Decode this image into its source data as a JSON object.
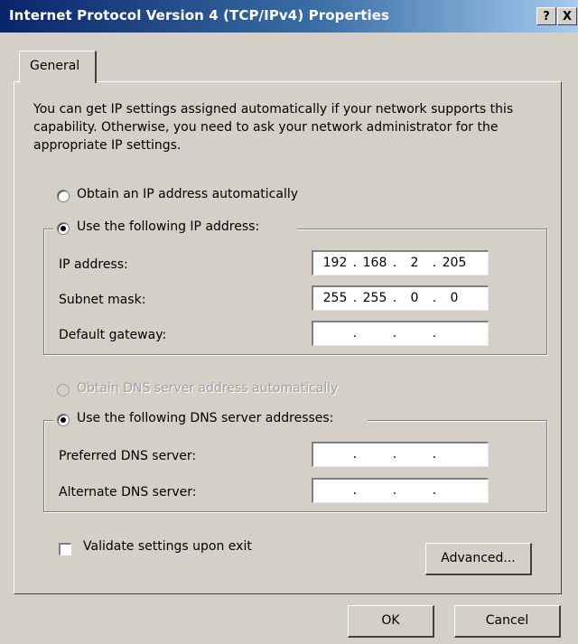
{
  "window": {
    "title": "Internet Protocol Version 4 (TCP/IPv4) Properties",
    "help_button": "?",
    "close_button": "X"
  },
  "tabs": [
    {
      "label": "General"
    }
  ],
  "description": "You can get IP settings assigned automatically if your network supports this capability. Otherwise, you need to ask your network administrator for the appropriate IP settings.",
  "ip_options": {
    "auto_label": "Obtain an IP address automatically",
    "manual_label": "Use the following IP address:",
    "selected": "manual"
  },
  "ip_fields": [
    {
      "label": "IP address:",
      "octets": [
        "192",
        "168",
        "2",
        "205"
      ]
    },
    {
      "label": "Subnet mask:",
      "octets": [
        "255",
        "255",
        "0",
        "0"
      ]
    },
    {
      "label": "Default gateway:",
      "octets": [
        "",
        "",
        "",
        ""
      ]
    }
  ],
  "dns_options": {
    "auto_label": "Obtain DNS server address automatically",
    "auto_disabled": true,
    "manual_label": "Use the following DNS server addresses:",
    "selected": "manual"
  },
  "dns_fields": [
    {
      "label": "Preferred DNS server:",
      "octets": [
        "",
        "",
        "",
        ""
      ]
    },
    {
      "label": "Alternate DNS server:",
      "octets": [
        "",
        "",
        "",
        ""
      ]
    }
  ],
  "validate": {
    "label": "Validate settings upon exit",
    "checked": false
  },
  "buttons": {
    "advanced": "Advanced...",
    "ok": "OK",
    "cancel": "Cancel"
  },
  "colors": {
    "dialog_bg": "#d4d0c8",
    "title_start": "#0a246a",
    "title_end": "#a6caf0"
  }
}
